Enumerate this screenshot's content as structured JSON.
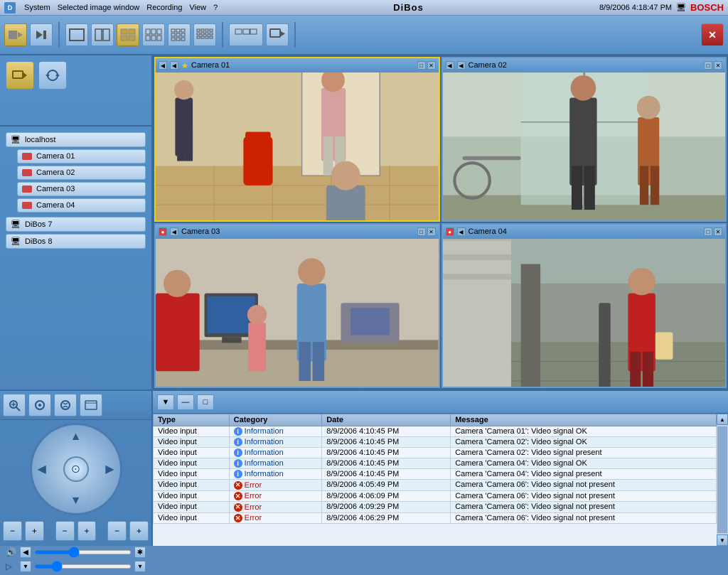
{
  "app": {
    "title": "DiBos",
    "datetime": "8/9/2006 4:18:47 PM",
    "bosch_label": "BOSCH"
  },
  "menu": {
    "items": [
      "System",
      "Selected image window",
      "Recording",
      "View",
      "?"
    ]
  },
  "toolbar": {
    "buttons": [
      "◀",
      "▶",
      "⏹",
      "⊞",
      "⊟",
      "grid1",
      "grid2",
      "grid3",
      "grid4",
      "grid5",
      "seq",
      "cam",
      "close"
    ]
  },
  "tree": {
    "host_label": "localhost",
    "cameras": [
      "Camera 01",
      "Camera 02",
      "Camera 03",
      "Camera 04"
    ],
    "servers": [
      "DiBos 7",
      "DiBos 8"
    ]
  },
  "cameras": [
    {
      "id": "cam01",
      "title": "Camera 01",
      "active": true,
      "has_star": true
    },
    {
      "id": "cam02",
      "title": "Camera 02",
      "active": false,
      "has_star": false
    },
    {
      "id": "cam03",
      "title": "Camera 03",
      "active": false,
      "has_star": false
    },
    {
      "id": "cam04",
      "title": "Camera 04",
      "active": false,
      "has_star": false
    }
  ],
  "log": {
    "columns": [
      "Type",
      "Category",
      "Date",
      "Message"
    ],
    "rows": [
      {
        "type": "Video input",
        "category_type": "info",
        "category": "Information",
        "date": "8/9/2006 4:10:45 PM",
        "message": "Camera 'Camera 01': Video signal OK"
      },
      {
        "type": "Video input",
        "category_type": "info",
        "category": "Information",
        "date": "8/9/2006 4:10:45 PM",
        "message": "Camera 'Camera 02': Video signal OK"
      },
      {
        "type": "Video input",
        "category_type": "info",
        "category": "Information",
        "date": "8/9/2006 4:10:45 PM",
        "message": "Camera 'Camera 02': Video signal present"
      },
      {
        "type": "Video input",
        "category_type": "info",
        "category": "Information",
        "date": "8/9/2006 4:10:45 PM",
        "message": "Camera 'Camera 04': Video signal OK"
      },
      {
        "type": "Video input",
        "category_type": "info",
        "category": "Information",
        "date": "8/9/2006 4:10:45 PM",
        "message": "Camera 'Camera 04': Video signal present"
      },
      {
        "type": "Video input",
        "category_type": "error",
        "category": "Error",
        "date": "8/9/2006 4:05:49 PM",
        "message": "Camera 'Camera 06': Video signal not present"
      },
      {
        "type": "Video input",
        "category_type": "error",
        "category": "Error",
        "date": "8/9/2006 4:06:09 PM",
        "message": "Camera 'Camera 06': Video signal not present"
      },
      {
        "type": "Video input",
        "category_type": "error",
        "category": "Error",
        "date": "8/9/2006 4:09:29 PM",
        "message": "Camera 'Camera 06': Video signal not present"
      },
      {
        "type": "Video input",
        "category_type": "error",
        "category": "Error",
        "date": "8/9/2006 4:06:29 PM",
        "message": "Camera 'Camera 06': Video signal not present"
      }
    ]
  }
}
